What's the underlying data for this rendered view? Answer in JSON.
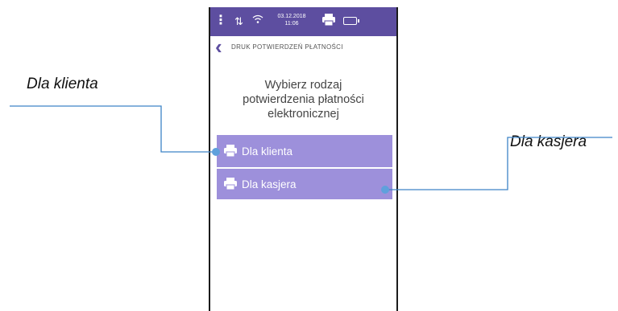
{
  "annotations": {
    "left_label": "Dla klienta",
    "right_label": "Dla kasjera"
  },
  "statusbar": {
    "date": "03.12.2018",
    "time": "11:06",
    "color": "#5d4ea0"
  },
  "header": {
    "title": "DRUK POTWIERDZEŃ PŁATNOŚCI"
  },
  "prompt": {
    "line1": "Wybierz rodzaj",
    "line2": "potwierdzenia płatności",
    "line3": "elektronicznej"
  },
  "options": [
    {
      "label": "Dla klienta",
      "icon": "printer-icon"
    },
    {
      "label": "Dla kasjera",
      "icon": "printer-icon"
    }
  ],
  "colors": {
    "accent": "#5d4ea0",
    "option_bg": "#9d90db",
    "callout_line": "#3d84c6",
    "callout_dot": "#5fa0dc"
  }
}
